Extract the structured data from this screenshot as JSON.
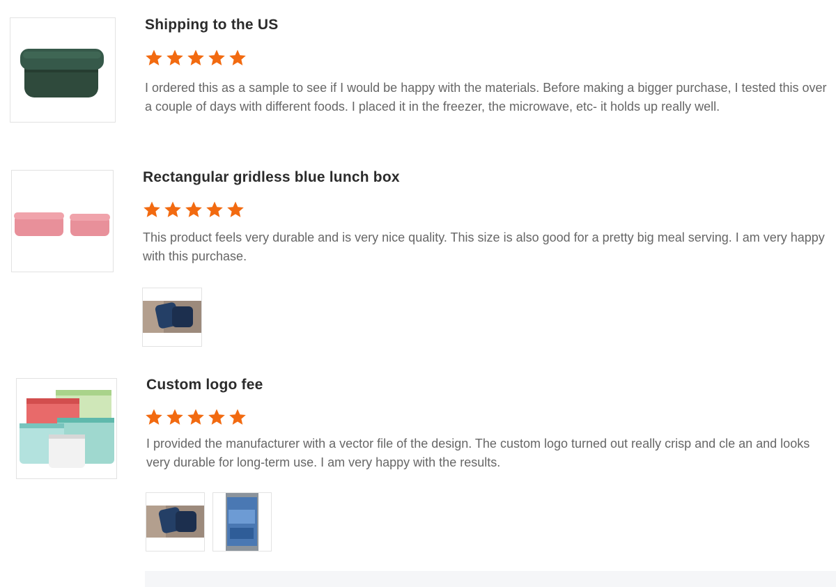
{
  "colors": {
    "star": "#f26a10",
    "title": "#2b2b2b",
    "body_text": "#666666",
    "border": "#e2e2e2"
  },
  "reviews": [
    {
      "title": "Shipping to the US",
      "rating": 5,
      "text": "I ordered this as a sample to see if I would be happy with the materials. Before making a bigger purchase, I tested this over a couple of days with different foods. I placed it in the freezer, the microwave, etc- it holds up really well.",
      "product_image": "dark-green-square-container-image",
      "photos": []
    },
    {
      "title": "Rectangular gridless blue lunch box",
      "rating": 5,
      "text": "This product feels very durable and is very nice quality. This size is also good for a pretty big meal serving. I am very happy with this purchase.",
      "product_image": "pink-containers-image",
      "photos": [
        "blue-lunchbox-photo"
      ]
    },
    {
      "title": "Custom logo fee",
      "rating": 5,
      "text": "I provided the manufacturer with a vector file of the design. The custom logo turned out really crisp and cle an and looks very durable for long-term use. I am very happy with the results.",
      "product_image": "silicone-bags-image",
      "photos": [
        "blue-lunchbox-photo",
        "blue-package-photo"
      ]
    }
  ]
}
